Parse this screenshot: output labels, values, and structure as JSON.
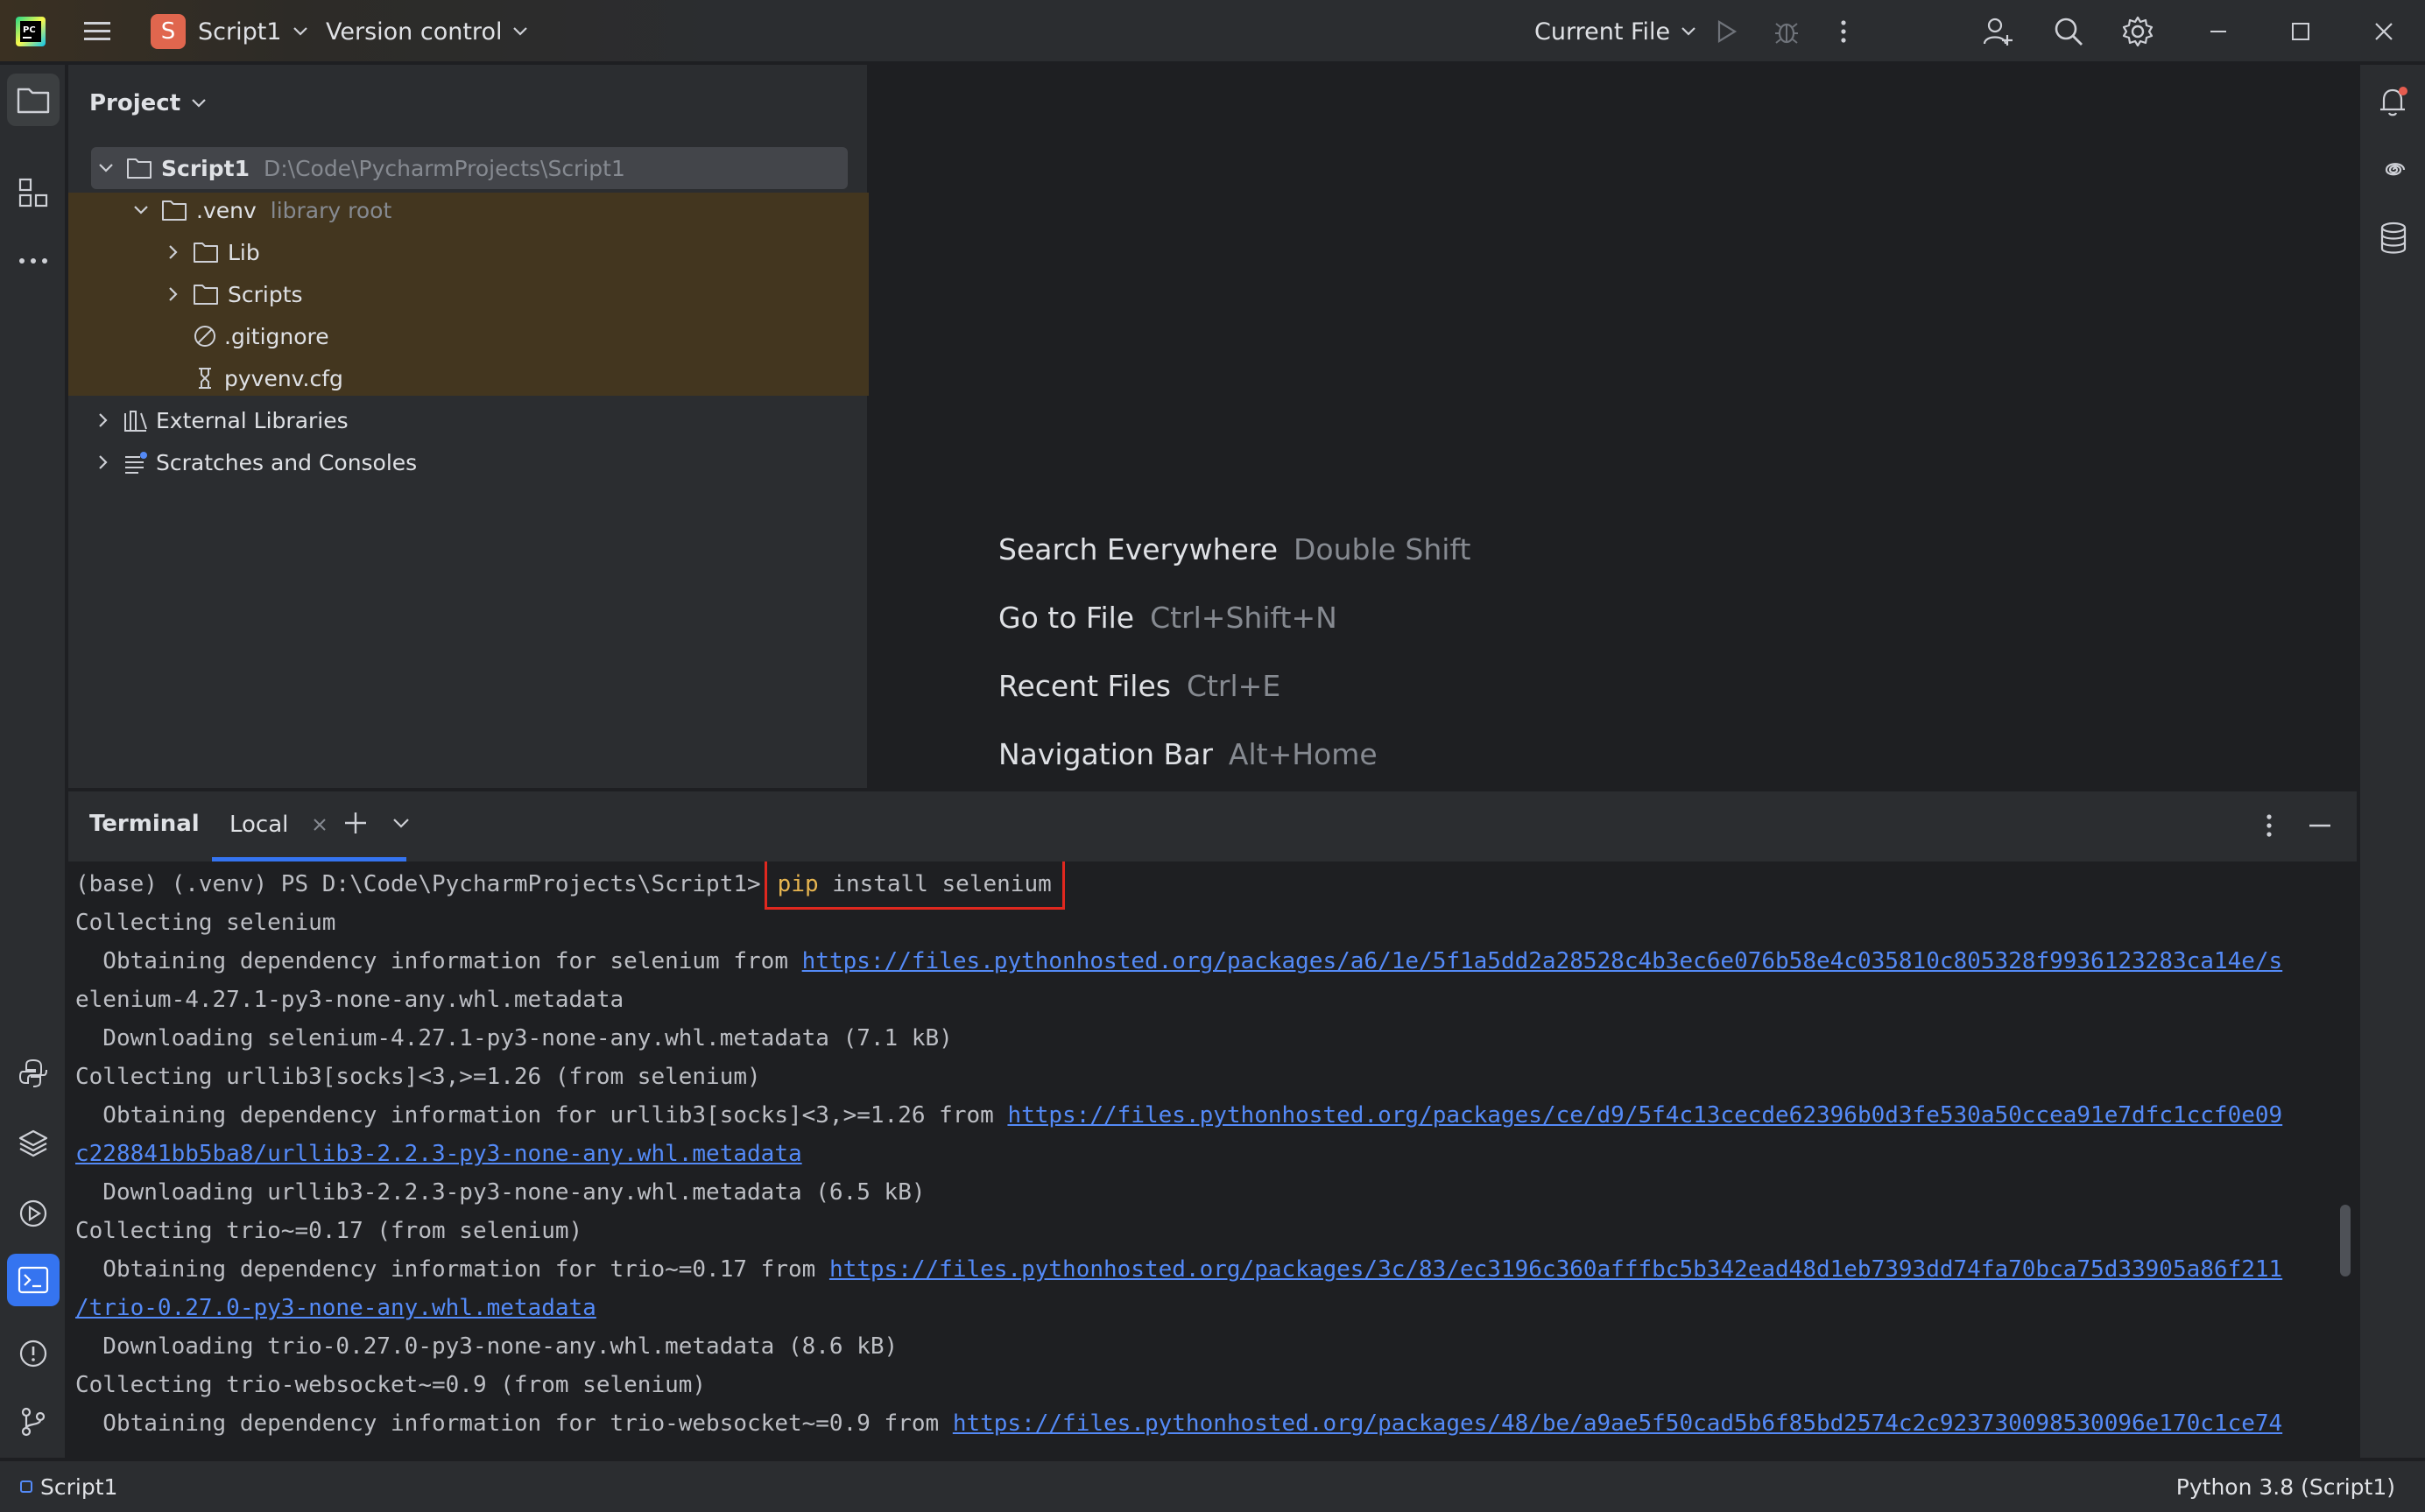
{
  "titlebar": {
    "project_badge": "S",
    "project_name": "Script1",
    "vcs_label": "Version control",
    "run_config": "Current File"
  },
  "project_panel": {
    "title": "Project",
    "tree": [
      {
        "label": "Script1",
        "detail": "D:\\Code\\PycharmProjects\\Script1"
      },
      {
        "label": ".venv",
        "detail": "library root"
      },
      {
        "label": "Lib"
      },
      {
        "label": "Scripts"
      },
      {
        "label": ".gitignore"
      },
      {
        "label": "pyvenv.cfg"
      },
      {
        "label": "External Libraries"
      },
      {
        "label": "Scratches and Consoles"
      }
    ]
  },
  "editor": {
    "hints": [
      {
        "label": "Search Everywhere",
        "shortcut": "Double Shift"
      },
      {
        "label": "Go to File",
        "shortcut": "Ctrl+Shift+N"
      },
      {
        "label": "Recent Files",
        "shortcut": "Ctrl+E"
      },
      {
        "label": "Navigation Bar",
        "shortcut": "Alt+Home"
      }
    ]
  },
  "terminal": {
    "title": "Terminal",
    "tab": "Local",
    "prompt": "(base) (.venv) PS D:\\Code\\PycharmProjects\\Script1>",
    "cmd_pip": "pip",
    "cmd_rest": " install selenium",
    "lines": [
      {
        "text": "Collecting selenium"
      },
      {
        "text": "  Obtaining dependency information for selenium from ",
        "link": "https://files.pythonhosted.org/packages/a6/1e/5f1a5dd2a28528c4b3ec6e076b58e4c035810c805328f9936123283ca14e/s"
      },
      {
        "text": "elenium-4.27.1-py3-none-any.whl.metadata"
      },
      {
        "text": "  Downloading selenium-4.27.1-py3-none-any.whl.metadata (7.1 kB)"
      },
      {
        "text": "Collecting urllib3[socks]<3,>=1.26 (from selenium)"
      },
      {
        "text": "  Obtaining dependency information for urllib3[socks]<3,>=1.26 from ",
        "link": "https://files.pythonhosted.org/packages/ce/d9/5f4c13cecde62396b0d3fe530a50ccea91e7dfc1ccf0e09"
      },
      {
        "text": "",
        "link": "c228841bb5ba8/urllib3-2.2.3-py3-none-any.whl.metadata"
      },
      {
        "text": "  Downloading urllib3-2.2.3-py3-none-any.whl.metadata (6.5 kB)"
      },
      {
        "text": "Collecting trio~=0.17 (from selenium)"
      },
      {
        "text": "  Obtaining dependency information for trio~=0.17 from ",
        "link": "https://files.pythonhosted.org/packages/3c/83/ec3196c360afffbc5b342ead48d1eb7393dd74fa70bca75d33905a86f211"
      },
      {
        "text": "",
        "link": "/trio-0.27.0-py3-none-any.whl.metadata"
      },
      {
        "text": "  Downloading trio-0.27.0-py3-none-any.whl.metadata (8.6 kB)"
      },
      {
        "text": "Collecting trio-websocket~=0.9 (from selenium)"
      },
      {
        "text": "  Obtaining dependency information for trio-websocket~=0.9 from ",
        "link": "https://files.pythonhosted.org/packages/48/be/a9ae5f50cad5b6f85bd2574c2c923730098530096e170c1ce74"
      }
    ]
  },
  "statusbar": {
    "project": "Script1",
    "interpreter": "Python 3.8 (Script1)"
  },
  "colors": {
    "accent": "#3574f0",
    "highlight_box": "#e0281f",
    "venv_bg": "#43361f",
    "link": "#548af7"
  }
}
